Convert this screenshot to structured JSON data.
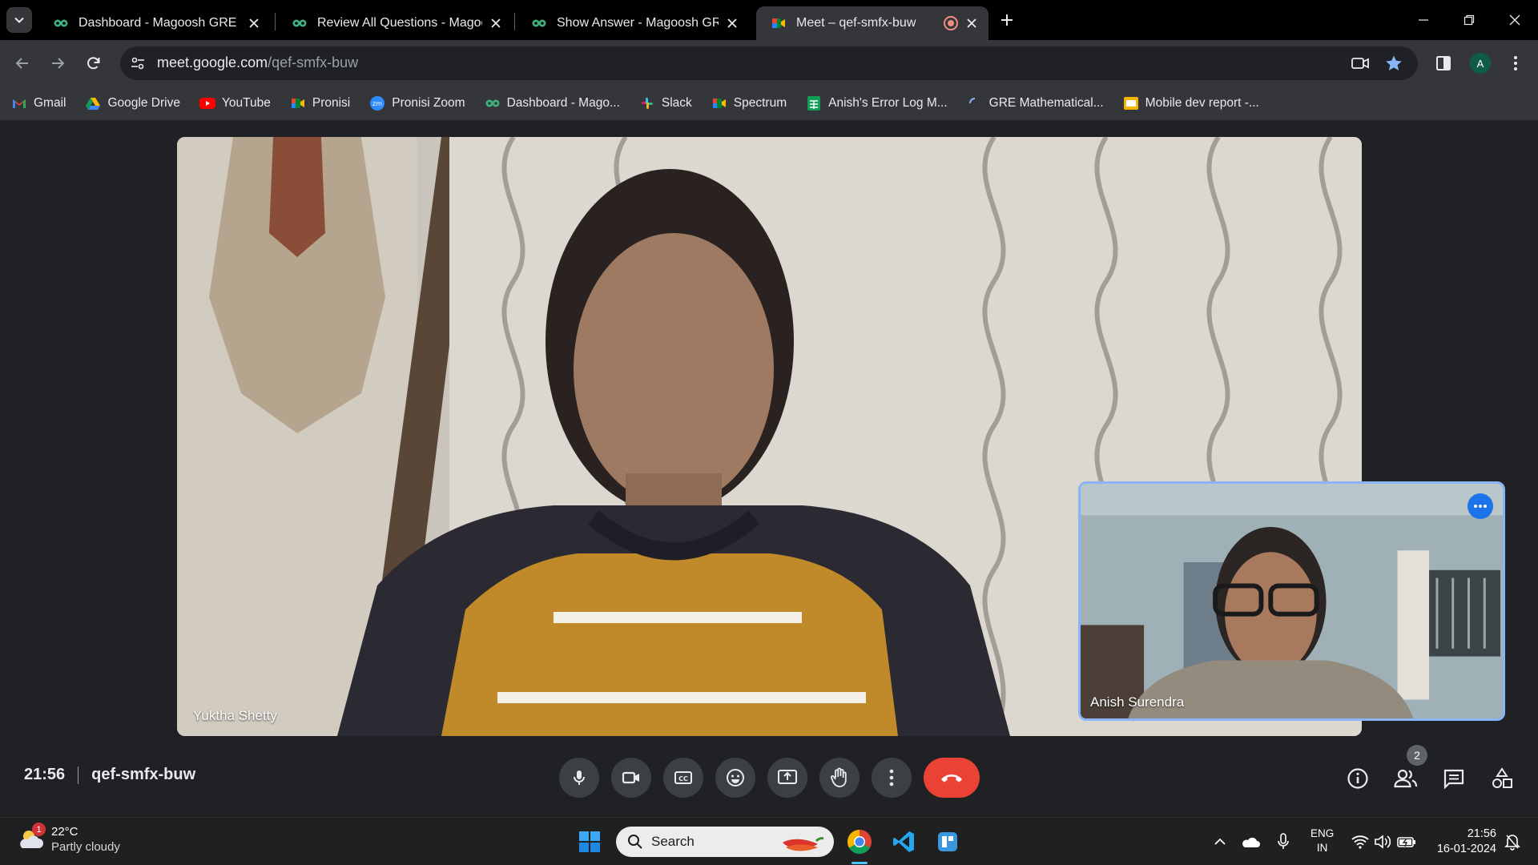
{
  "browser": {
    "tabs": [
      {
        "title": "Dashboard - Magoosh GRE",
        "active": false
      },
      {
        "title": "Review All Questions - Magoosh GRE",
        "active": false
      },
      {
        "title": "Show Answer - Magoosh GRE",
        "active": false
      },
      {
        "title": "Meet – qef-smfx-buw",
        "active": true
      }
    ],
    "url_host": "meet.google.com",
    "url_path": "/qef-smfx-buw",
    "profile_initial": "A",
    "bookmarks": [
      {
        "label": "Gmail",
        "icon": "gmail-icon"
      },
      {
        "label": "Google Drive",
        "icon": "google-drive-icon"
      },
      {
        "label": "YouTube",
        "icon": "youtube-icon"
      },
      {
        "label": "Pronisi",
        "icon": "meet-icon"
      },
      {
        "label": "Pronisi Zoom",
        "icon": "zoom-icon"
      },
      {
        "label": "Dashboard - Mago...",
        "icon": "magoosh-icon"
      },
      {
        "label": "Slack",
        "icon": "slack-icon"
      },
      {
        "label": "Spectrum",
        "icon": "meet-icon"
      },
      {
        "label": "Anish's Error Log M...",
        "icon": "sheets-icon"
      },
      {
        "label": "GRE Mathematical...",
        "icon": "loading-icon"
      },
      {
        "label": "Mobile dev report -...",
        "icon": "slides-icon"
      }
    ]
  },
  "meet": {
    "main_participant": "Yuktha Shetty",
    "self_participant": "Anish Surendra",
    "time": "21:56",
    "meeting_code": "qef-smfx-buw",
    "participant_count": "2",
    "controls": [
      "microphone",
      "camera",
      "captions",
      "emoji-reactions",
      "present-screen",
      "raise-hand",
      "more-options",
      "leave-call"
    ],
    "side_controls": [
      "meeting-details",
      "people",
      "chat",
      "activities"
    ]
  },
  "taskbar": {
    "weather_temp": "22°C",
    "weather_cond": "Partly cloudy",
    "weather_badge": "1",
    "search_label": "Search",
    "lang_top": "ENG",
    "lang_bottom": "IN",
    "clock_time": "21:56",
    "clock_date": "16-01-2024"
  },
  "colors": {
    "meet_bg": "#202124",
    "end_call": "#ea4335",
    "self_tile_border": "#8ab4f8",
    "accent_blue": "#1a73e8"
  }
}
